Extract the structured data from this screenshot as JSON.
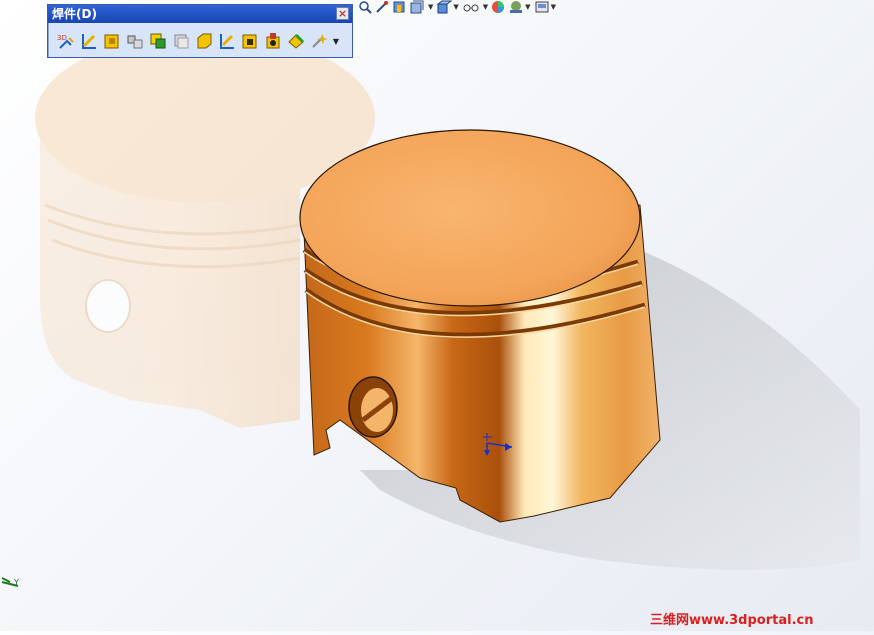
{
  "toolbar": {
    "title": "焊件(D)",
    "close_label": "×",
    "tools": [
      {
        "name": "3d-sketch-icon",
        "label": "3D"
      },
      {
        "name": "structural-member-icon"
      },
      {
        "name": "gusset-icon"
      },
      {
        "name": "end-cap-icon"
      },
      {
        "name": "weld-bead-icon"
      },
      {
        "name": "cut-list-icon"
      },
      {
        "name": "extruded-boss-icon"
      },
      {
        "name": "trim-extend-icon"
      },
      {
        "name": "extruded-cut-icon"
      },
      {
        "name": "hole-wizard-icon"
      },
      {
        "name": "chamfer-icon"
      },
      {
        "name": "fillet-bead-icon"
      }
    ]
  },
  "view_toolbar": {
    "icons": [
      "zoom-icon",
      "pan-icon",
      "view-orient-icon",
      "section-view-icon",
      "display-style-icon",
      "hide-show-icon",
      "appearance-icon",
      "scene-icon",
      "view-settings-icon"
    ]
  },
  "triad": {
    "axis_label": "Y"
  },
  "watermark": {
    "text": "三维网www.3dportal.cn"
  },
  "colors": {
    "piston_light": "#fbd29a",
    "piston_mid": "#f0a04f",
    "piston_dark": "#b85a10",
    "shadow": "#c9ccd2",
    "watermark": "#d91f1f"
  }
}
